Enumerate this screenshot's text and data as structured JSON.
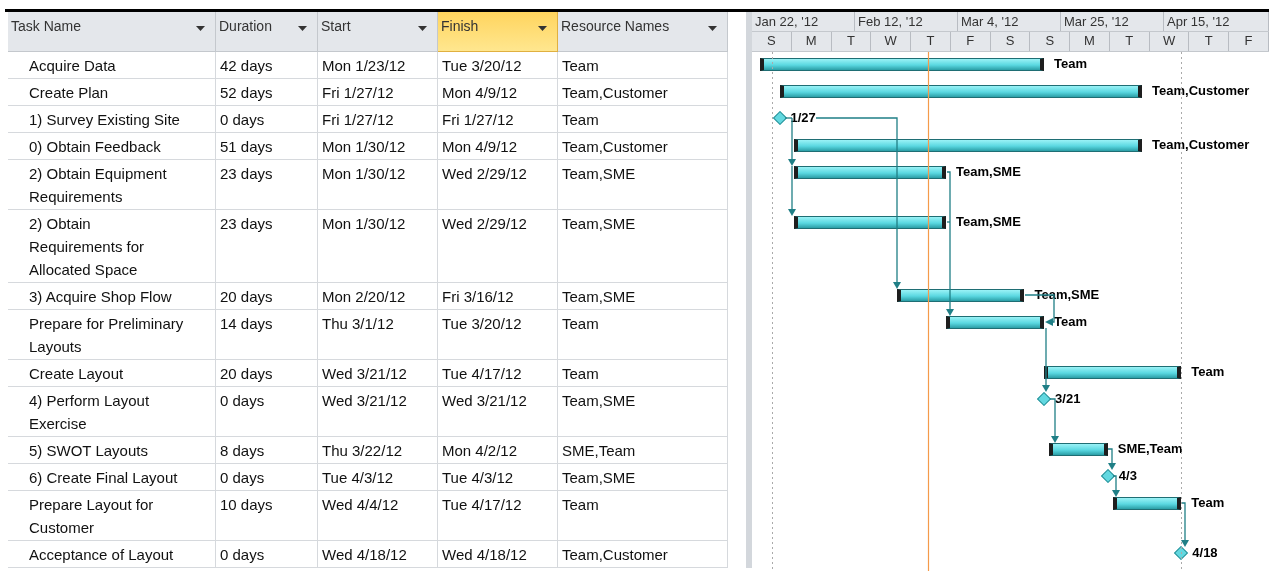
{
  "columns": [
    {
      "label": "Task Name",
      "selected": false
    },
    {
      "label": "Duration",
      "selected": false
    },
    {
      "label": "Start",
      "selected": false
    },
    {
      "label": "Finish",
      "selected": true
    },
    {
      "label": "Resource Names",
      "selected": false
    }
  ],
  "timescale": {
    "major": [
      "Jan 22, '12",
      "Feb 12, '12",
      "Mar 4, '12",
      "Mar 25, '12",
      "Apr 15, '12"
    ],
    "minor": [
      "S",
      "M",
      "T",
      "W",
      "T",
      "F",
      "S",
      "S",
      "M",
      "T",
      "W",
      "T",
      "F"
    ]
  },
  "tasks": [
    {
      "name": "Acquire Data",
      "duration": "42 days",
      "start": "Mon 1/23/12",
      "finish": "Tue 3/20/12",
      "resources": "Team",
      "bar": {
        "kind": "bar",
        "label": "Team"
      }
    },
    {
      "name": "Create Plan",
      "duration": "52 days",
      "start": "Fri 1/27/12",
      "finish": "Mon 4/9/12",
      "resources": "Team,Customer",
      "bar": {
        "kind": "bar",
        "label": "Team,Customer"
      }
    },
    {
      "name": "1) Survey Existing Site",
      "duration": "0 days",
      "start": "Fri 1/27/12",
      "finish": "Fri 1/27/12",
      "resources": "Team",
      "bar": {
        "kind": "milestone",
        "label": "1/27"
      }
    },
    {
      "name": "0) Obtain Feedback",
      "duration": "51 days",
      "start": "Mon 1/30/12",
      "finish": "Mon 4/9/12",
      "resources": "Team,Customer",
      "bar": {
        "kind": "bar",
        "label": "Team,Customer"
      }
    },
    {
      "name": "2) Obtain Equipment Requirements",
      "duration": "23 days",
      "start": "Mon 1/30/12",
      "finish": "Wed 2/29/12",
      "resources": "Team,SME",
      "bar": {
        "kind": "bar",
        "label": "Team,SME"
      }
    },
    {
      "name": "2) Obtain Requirements for Allocated Space",
      "duration": "23 days",
      "start": "Mon 1/30/12",
      "finish": "Wed 2/29/12",
      "resources": "Team,SME",
      "bar": {
        "kind": "bar",
        "label": "Team,SME"
      }
    },
    {
      "name": "3) Acquire Shop Flow",
      "duration": "20 days",
      "start": "Mon 2/20/12",
      "finish": "Fri 3/16/12",
      "resources": "Team,SME",
      "bar": {
        "kind": "bar",
        "label": "Team,SME"
      }
    },
    {
      "name": "Prepare for Preliminary Layouts",
      "duration": "14 days",
      "start": "Thu 3/1/12",
      "finish": "Tue 3/20/12",
      "resources": "Team",
      "bar": {
        "kind": "bar",
        "label": "Team"
      }
    },
    {
      "name": "Create Layout",
      "duration": "20 days",
      "start": "Wed 3/21/12",
      "finish": "Tue 4/17/12",
      "resources": "Team",
      "bar": {
        "kind": "bar",
        "label": "Team"
      }
    },
    {
      "name": "4) Perform Layout Exercise",
      "duration": "0 days",
      "start": "Wed 3/21/12",
      "finish": "Wed 3/21/12",
      "resources": "Team,SME",
      "bar": {
        "kind": "milestone",
        "label": "3/21"
      }
    },
    {
      "name": "5) SWOT Layouts",
      "duration": "8 days",
      "start": "Thu 3/22/12",
      "finish": "Mon 4/2/12",
      "resources": "SME,Team",
      "bar": {
        "kind": "bar",
        "label": "SME,Team"
      }
    },
    {
      "name": "6) Create Final Layout",
      "duration": "0 days",
      "start": "Tue 4/3/12",
      "finish": "Tue 4/3/12",
      "resources": "Team,SME",
      "bar": {
        "kind": "milestone",
        "label": "4/3"
      }
    },
    {
      "name": "Prepare Layout for Customer",
      "duration": "10 days",
      "start": "Wed 4/4/12",
      "finish": "Tue 4/17/12",
      "resources": "Team",
      "bar": {
        "kind": "bar",
        "label": "Team"
      }
    },
    {
      "name": "Acceptance of Layout",
      "duration": "0 days",
      "start": "Wed 4/18/12",
      "finish": "Wed 4/18/12",
      "resources": "Team,Customer",
      "bar": {
        "kind": "milestone",
        "label": "4/18"
      }
    }
  ]
}
